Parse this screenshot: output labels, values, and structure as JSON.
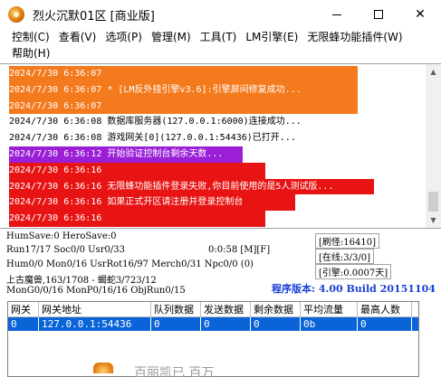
{
  "window": {
    "title": "烈火沉默01区 [商业版]",
    "minimize": "—",
    "maximize": "□",
    "close": "✕"
  },
  "menu": {
    "row1": [
      "控制(C)",
      "查看(V)",
      "选项(P)",
      "管理(M)",
      "工具(T)",
      "LM引擎(E)",
      "无限蜂功能插件(W)"
    ],
    "row2": [
      "帮助(H)"
    ]
  },
  "log": [
    {
      "text": "2024/7/30 6:36:07",
      "color": "orange",
      "bar": 385
    },
    {
      "text": "2024/7/30 6:36:07 * [LM反外挂引擎v3.6]:引擎屏间修复成功...",
      "color": "orange",
      "bar": 385
    },
    {
      "text": "2024/7/30 6:36:07",
      "color": "orange",
      "bar": 385
    },
    {
      "text": "2024/7/30 6:36:08 数据库服务器(127.0.0.1:6000)连接成功...",
      "color": "plain",
      "bar": 0
    },
    {
      "text": "2024/7/30 6:36:08 游戏网关[0](127.0.0.1:54436)已打开...",
      "color": "plain",
      "bar": 0
    },
    {
      "text": "2024/7/30 6:36:12 开始验证控制台剩余天数...",
      "color": "purple",
      "bar": 258
    },
    {
      "text": "2024/7/30 6:36:16",
      "color": "red",
      "bar": 283
    },
    {
      "text": "2024/7/30 6:36:16 无限蜂功能插件登录失败,你目前使用的是5人测试版...",
      "color": "red",
      "bar": 403
    },
    {
      "text": "2024/7/30 6:36:16 如果正式开区请注册并登录控制台",
      "color": "red",
      "bar": 316
    },
    {
      "text": "2024/7/30 6:36:16",
      "color": "red",
      "bar": 283
    }
  ],
  "status": {
    "line1": "HumSave:0 HeroSave:0",
    "line2_left": "Run17/17 Soc0/0 Usr0/33",
    "line2_right": "0:0:58 [M][F]",
    "line3": "Hum0/0 Mon0/16 UsrRot16/97 Merch0/31 Npc0/0 (0)",
    "line4": "上古魔兽,163/1708 - 蝎蛇3/723/12",
    "line5": "MonG0/0/16 MonP0/16/16 ObjRun0/15",
    "refresh": "[刷怪:16410]",
    "online": "[在线:3/3/0]",
    "engine": "[引擎:0.0007天]",
    "version": "程序版本: 4.00 Build 20151104"
  },
  "table": {
    "headers": [
      "网关",
      "网关地址",
      "队列数据",
      "发送数据",
      "剩余数据",
      "平均流量",
      "最高人数"
    ],
    "rows": [
      [
        "0",
        "127.0.0.1:54436",
        "0",
        "0",
        "0",
        "0b",
        "0"
      ]
    ]
  },
  "taskbar_hint": "百丽凯已 百万"
}
